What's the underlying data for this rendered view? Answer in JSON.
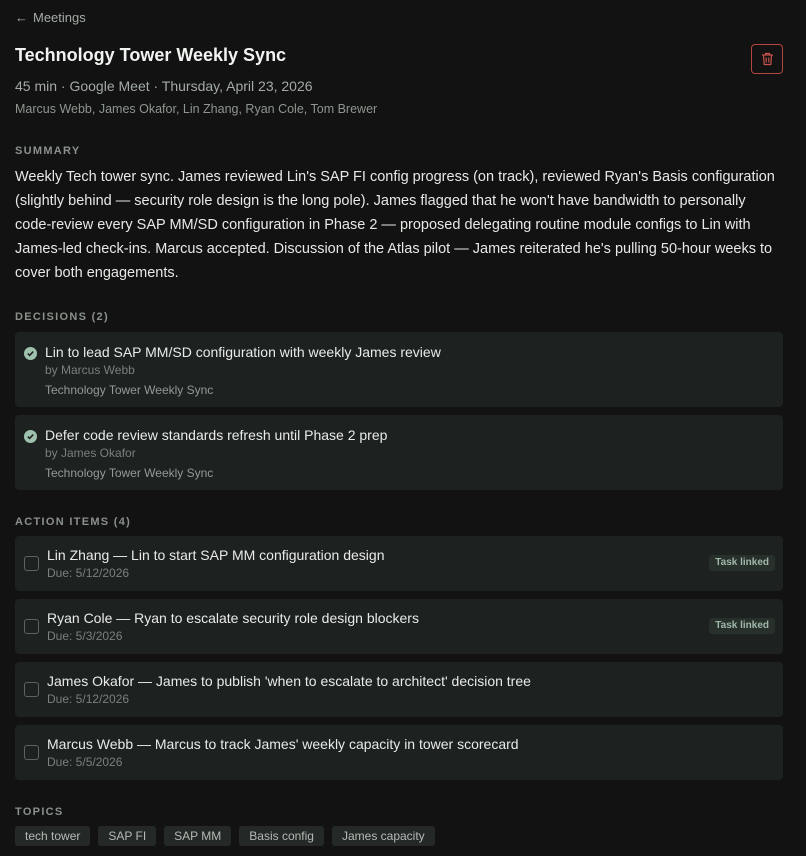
{
  "nav": {
    "back_label": "Meetings",
    "back_icon": "arrow-left-icon"
  },
  "meeting": {
    "title": "Technology Tower Weekly Sync",
    "meta": "45 min · Google Meet · Thursday, April 23, 2026",
    "attendees": "Marcus Webb, James Okafor, Lin Zhang, Ryan Cole, Tom Brewer",
    "delete_icon": "trash-icon",
    "delete_color": "#b3463f"
  },
  "summary": {
    "label": "SUMMARY",
    "text": "Weekly Tech tower sync. James reviewed Lin's SAP FI config progress (on track), reviewed Ryan's Basis configuration (slightly behind — security role design is the long pole). James flagged that he won't have bandwidth to personally code-review every SAP MM/SD configuration in Phase 2 — proposed delegating routine module configs to Lin with James-led check-ins. Marcus accepted. Discussion of the Atlas pilot — James reiterated he's pulling 50-hour weeks to cover both engagements."
  },
  "decisions": {
    "label": "DECISIONS (2)",
    "items": [
      {
        "title": "Lin to lead SAP MM/SD configuration with weekly James review",
        "by": "by Marcus Webb",
        "meeting": "Technology Tower Weekly Sync"
      },
      {
        "title": "Defer code review standards refresh until Phase 2 prep",
        "by": "by James Okafor",
        "meeting": "Technology Tower Weekly Sync"
      }
    ]
  },
  "actions": {
    "label": "ACTION ITEMS (4)",
    "items": [
      {
        "title": "Lin Zhang — Lin to start SAP MM configuration design",
        "due": "Due: 5/12/2026",
        "badge": "Task linked"
      },
      {
        "title": "Ryan Cole — Ryan to escalate security role design blockers",
        "due": "Due: 5/3/2026",
        "badge": "Task linked"
      },
      {
        "title": "James Okafor — James to publish 'when to escalate to architect' decision tree",
        "due": "Due: 5/12/2026",
        "badge": ""
      },
      {
        "title": "Marcus Webb — Marcus to track James' weekly capacity in tower scorecard",
        "due": "Due: 5/5/2026",
        "badge": ""
      }
    ]
  },
  "topics": {
    "label": "TOPICS",
    "items": [
      "tech tower",
      "SAP FI",
      "SAP MM",
      "Basis config",
      "James capacity"
    ]
  },
  "colors": {
    "background": "#111211",
    "card": "#1d2120",
    "accent_green": "#9fc2ad",
    "danger": "#b3463f"
  }
}
